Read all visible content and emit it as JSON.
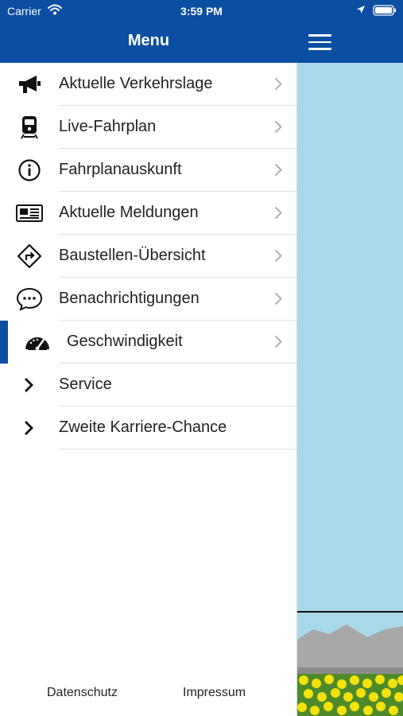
{
  "status": {
    "carrier": "Carrier",
    "time": "3:59 PM"
  },
  "header": {
    "title": "Menu"
  },
  "menu": {
    "items": [
      {
        "label": "Aktuelle Verkehrslage",
        "icon": "megaphone-icon"
      },
      {
        "label": "Live-Fahrplan",
        "icon": "train-icon"
      },
      {
        "label": "Fahrplanauskunft",
        "icon": "info-icon"
      },
      {
        "label": "Aktuelle Meldungen",
        "icon": "newspaper-icon"
      },
      {
        "label": "Baustellen-Übersicht",
        "icon": "detour-sign-icon"
      },
      {
        "label": "Benachrichtigungen",
        "icon": "chat-bubble-icon"
      },
      {
        "label": "Geschwindigkeit",
        "icon": "speedometer-icon",
        "active": true
      },
      {
        "label": "Service",
        "icon": "chevron-right-icon"
      },
      {
        "label": "Zweite Karriere-Chance",
        "icon": "chevron-right-icon"
      }
    ]
  },
  "footer": {
    "privacy": "Datenschutz",
    "imprint": "Impressum"
  },
  "colors": {
    "brand": "#0b4ea2",
    "sky": "#a9d8ea",
    "flowers": "#f3e20c"
  }
}
